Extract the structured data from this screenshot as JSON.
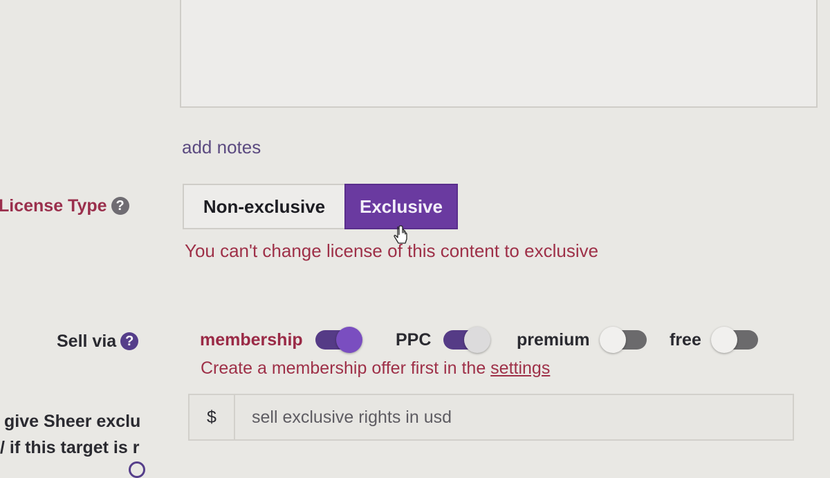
{
  "notes": {
    "add_notes_link": "add notes"
  },
  "license": {
    "label": "License Type",
    "help_icon": "?",
    "options": [
      "Non-exclusive",
      "Exclusive"
    ],
    "selected": "Exclusive",
    "error": "You can't change license of this content to exclusive"
  },
  "sell_via": {
    "label": "Sell via",
    "help_icon": "?",
    "toggles": [
      {
        "label": "membership",
        "on": true
      },
      {
        "label": "PPC",
        "on": true
      },
      {
        "label": "premium",
        "on": false
      },
      {
        "label": "free",
        "on": false
      }
    ],
    "error_prefix": "Create a membership offer first in the ",
    "error_link": "settings"
  },
  "price": {
    "currency_symbol": "$",
    "placeholder": "sell exclusive rights in usd"
  },
  "cut_off": {
    "line1": "give Sheer exclu",
    "line2": "/ if this target is r"
  },
  "colors": {
    "accent": "#6a3aa0",
    "error": "#9e3048",
    "background": "#e9e8e4"
  }
}
